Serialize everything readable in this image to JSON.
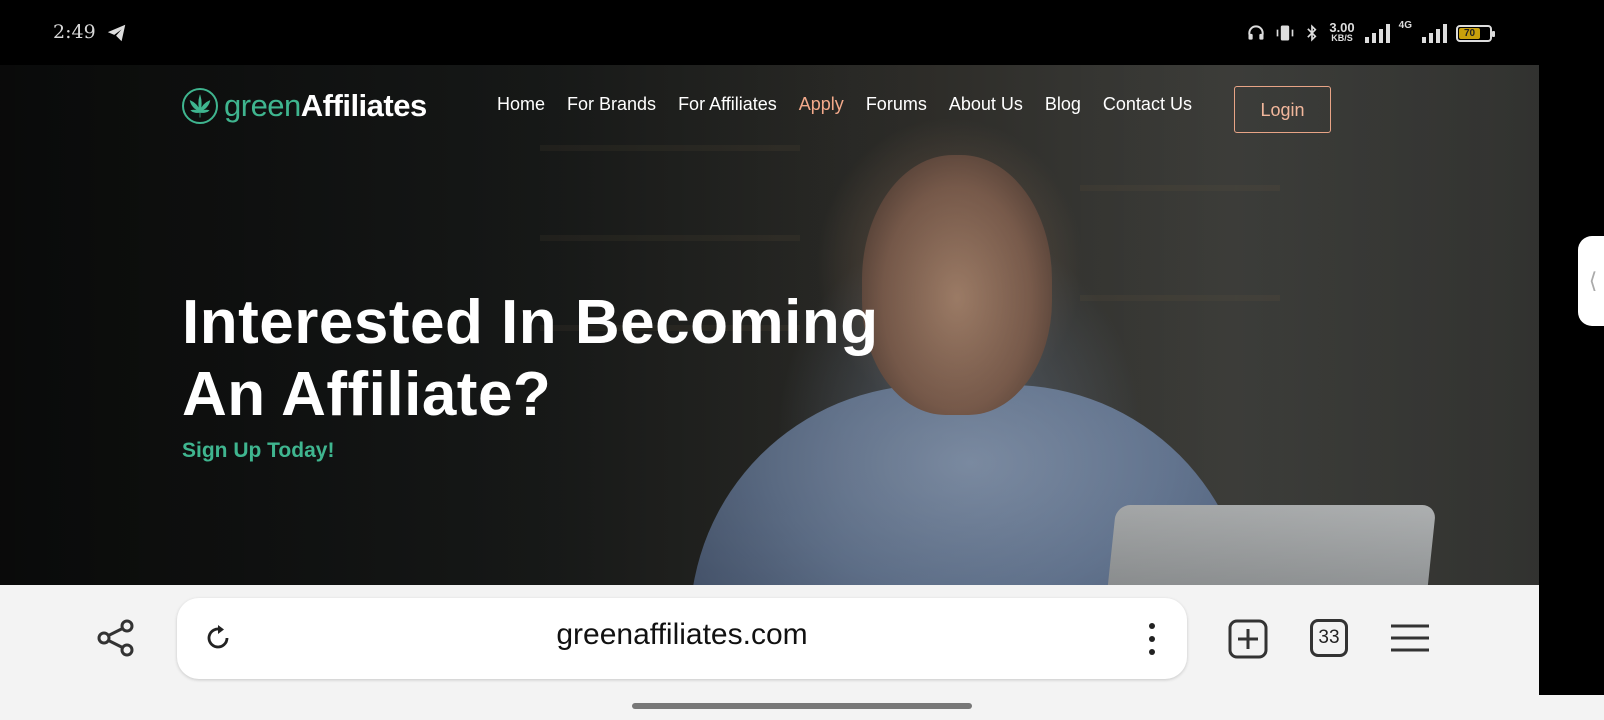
{
  "status_bar": {
    "time": "2:49",
    "speed_value": "3.00",
    "speed_unit": "KB/S",
    "network_type": "4G",
    "battery_level": "70"
  },
  "site": {
    "logo": {
      "green_part": "green",
      "bold_part": "Affiliates"
    },
    "nav": [
      {
        "label": "Home",
        "active": false
      },
      {
        "label": "For Brands",
        "active": false
      },
      {
        "label": "For Affiliates",
        "active": false
      },
      {
        "label": "Apply",
        "active": true
      },
      {
        "label": "Forums",
        "active": false
      },
      {
        "label": "About Us",
        "active": false
      },
      {
        "label": "Blog",
        "active": false
      },
      {
        "label": "Contact Us",
        "active": false
      }
    ],
    "login_label": "Login",
    "hero": {
      "title": "Interested In Becoming An Affiliate?",
      "cta": "Sign Up Today!"
    },
    "colors": {
      "brand_green": "#3fb58f",
      "accent_peach": "#f2a98a"
    }
  },
  "browser": {
    "url": "greenaffiliates.com",
    "tab_count": "33"
  }
}
